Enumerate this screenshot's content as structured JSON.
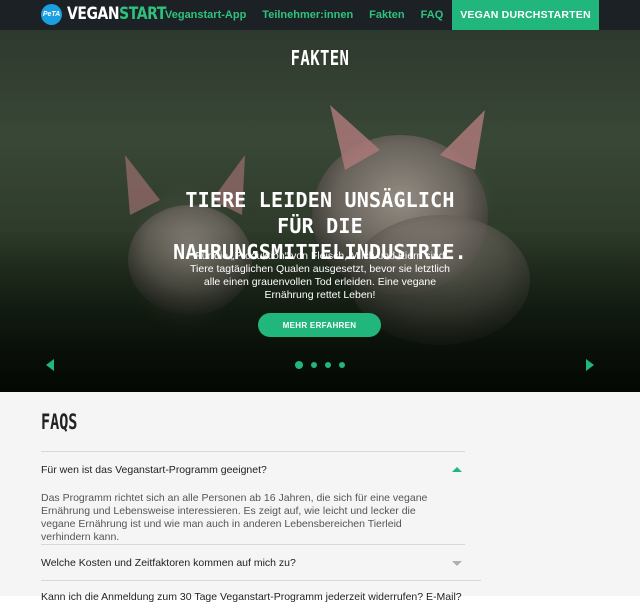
{
  "brand": {
    "badge": "PeTA",
    "name_white": "VEGAN",
    "name_green": "START"
  },
  "nav": {
    "links": [
      "Veganstart-App",
      "Teilnehmer:innen",
      "Fakten",
      "FAQ"
    ],
    "cta": "VEGAN DURCHSTARTEN"
  },
  "hero": {
    "label": "FAKTEN",
    "title": "TIERE LEIDEN UNSÄGLICH FÜR DIE NAHRUNGSMITTELINDUSTRIE.",
    "text": "Für die „Produktion“ von Fleisch, Milch und Eiern sind Tiere tagtäglichen Qualen ausgesetzt, bevor sie letztlich alle einen grauenvollen Tod erleiden. Eine vegane Ernährung rettet Leben!",
    "button": "MEHR ERFAHREN"
  },
  "faq": {
    "title": "FAQS",
    "items": [
      {
        "question": "Für wen ist das Veganstart-Programm geeignet?",
        "answer": "Das Programm richtet sich an alle Personen ab 16 Jahren, die sich für eine vegane Ernährung und Lebensweise interessieren. Es zeigt auf, wie leicht und lecker die vegane Ernährung ist und wie man auch in anderen Lebensbereichen Tierleid verhindern kann."
      },
      {
        "question": "Welche Kosten und Zeitfaktoren kommen auf mich zu?"
      },
      {
        "question": "Kann ich die Anmeldung zum 30 Tage Veganstart-Programm jederzeit widerrufen? E-Mail?"
      }
    ]
  },
  "colors": {
    "accent": "#21b67c",
    "nav_bg": "#1c2126",
    "peta_blue": "#1a9fe0"
  }
}
